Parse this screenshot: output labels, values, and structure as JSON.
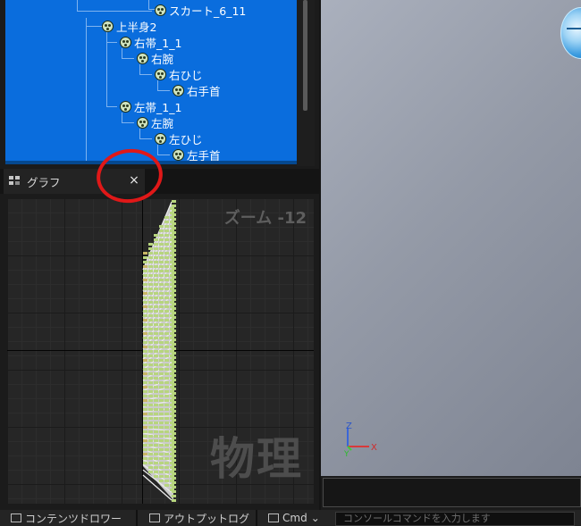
{
  "skeleton_tree": [
    {
      "label": "スカート_6_11"
    },
    {
      "label": "上半身2"
    },
    {
      "label": "右帯_1_1"
    },
    {
      "label": "右腕"
    },
    {
      "label": "右ひじ"
    },
    {
      "label": "右手首"
    },
    {
      "label": "左帯_1_1"
    },
    {
      "label": "左腕"
    },
    {
      "label": "左ひじ"
    },
    {
      "label": "左手首"
    }
  ],
  "graph_panel": {
    "tab_label": "グラフ",
    "close_glyph": "×",
    "zoom_label": "ズーム -12",
    "watermark": "物理"
  },
  "bottom_bar": {
    "content_drawer": "コンテンツドロワー",
    "output_log": "アウトプットログ",
    "cmd": "Cmd",
    "cmd_chevron": "⌄",
    "console_placeholder": "コンソールコマンドを入力します"
  },
  "viewport": {
    "axis_z": "Z",
    "axis_y": "Y",
    "axis_x": "X"
  },
  "colors": {
    "selection_blue": "#0a6ddd",
    "annotation_red": "#e01818",
    "node_green": "#b7d57e"
  }
}
